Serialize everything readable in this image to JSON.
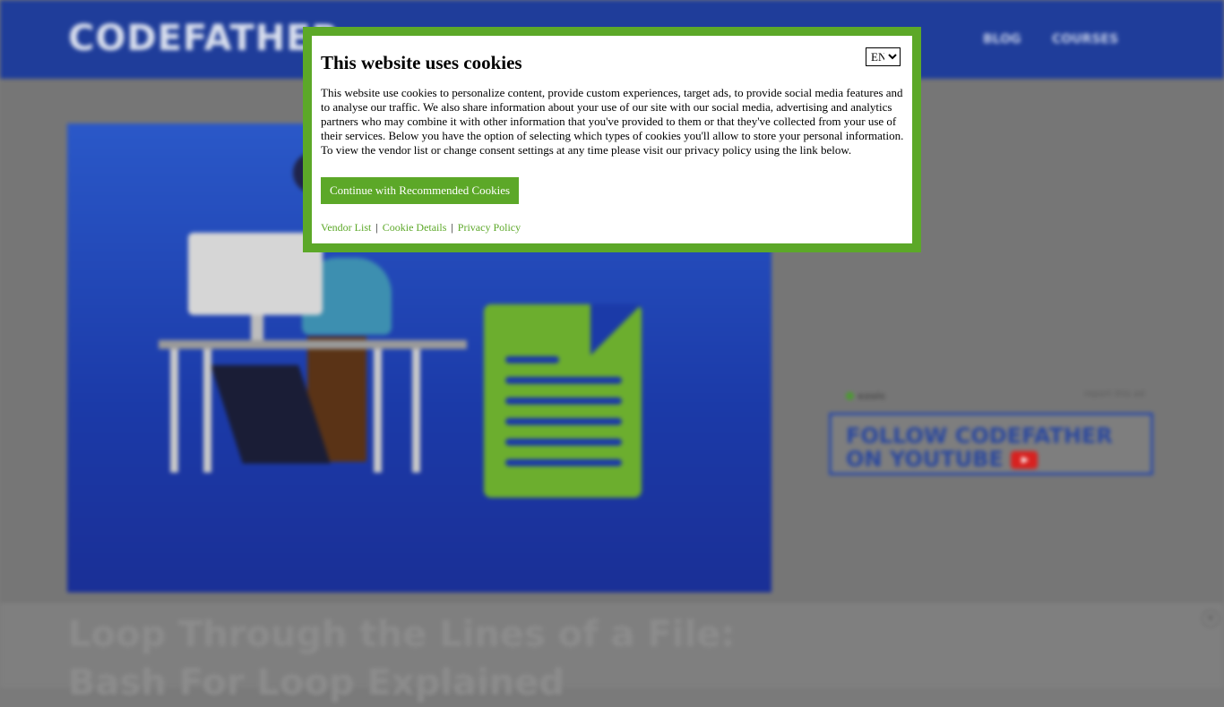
{
  "site": {
    "logo": "CODEFATHER",
    "nav": [
      "BLOG",
      "COURSES"
    ]
  },
  "article": {
    "title": "Loop Through the Lines of a File: Bash For Loop Explained"
  },
  "sidebar": {
    "ad_label": "ezoic",
    "ad_report": "report this ad",
    "youtube_cta": "FOLLOW CODEFATHER ON YOUTUBE"
  },
  "cookie_modal": {
    "title": "This website uses cookies",
    "language": "EN",
    "language_options": [
      "EN"
    ],
    "text": "This website use cookies to personalize content, provide custom experiences, target ads, to provide social media features and to analyse our traffic. We also share information about your use of our site with our social media, advertising and analytics partners who may combine it with other information that you've provided to them or that they've collected from your use of their services. Below you have the option of selecting which types of cookies you'll allow to store your personal information. To view the vendor list or change consent settings at any time please visit our privacy policy using the link below.",
    "accept_button": "Continue with Recommended Cookies",
    "links": {
      "vendor_list": "Vendor List",
      "cookie_details": "Cookie Details",
      "privacy_policy": "Privacy Policy",
      "separator": "|"
    }
  },
  "colors": {
    "accent_green": "#5ca828",
    "header_blue": "#1f3d9a"
  },
  "icons": {
    "close": "close-icon",
    "youtube": "youtube-icon"
  }
}
